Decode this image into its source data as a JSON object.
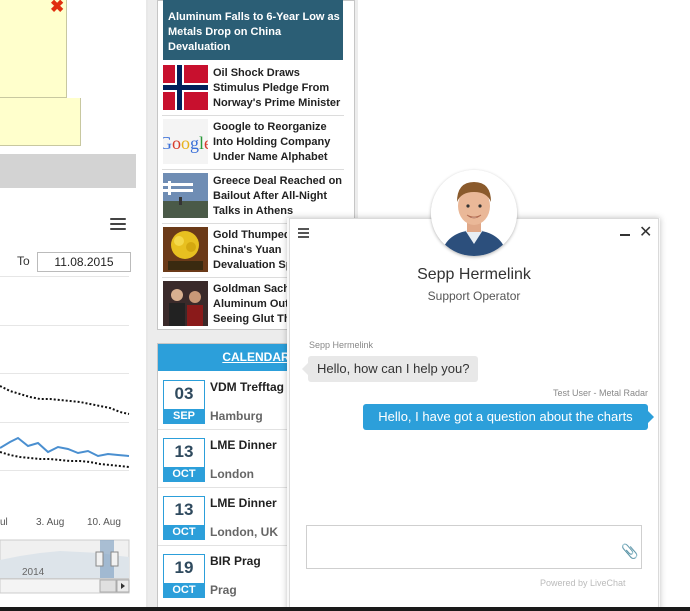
{
  "left_panel": {
    "close_glyph": "✖",
    "to_label": "To",
    "to_date": "11.08.2015",
    "x_ticks": [
      "ul",
      "3. Aug",
      "10. Aug"
    ],
    "navigator_year": "2014",
    "colors": {
      "line_blue": "#4a8fd0",
      "line_dotted": "#111111",
      "note_bg": "#ffffcc"
    }
  },
  "news": {
    "feature_title": "Aluminum Falls to 6-Year Low as Metals Drop on China Devaluation",
    "items": [
      {
        "title_lines": [
          "Oil Shock Draws",
          "Stimulus Pledge From",
          "Norway's Prime Minister"
        ],
        "thumb": "norway-flag-icon"
      },
      {
        "title_lines": [
          "Google to Reorganize",
          "Into Holding Company",
          "Under Name Alphabet"
        ],
        "thumb": "google-logo-icon"
      },
      {
        "title_lines": [
          "Greece Deal Reached on",
          "Bailout After All-Night",
          "Talks in Athens"
        ],
        "thumb": "greece-flag-icon"
      },
      {
        "title_lines": [
          "Gold Thumped",
          "China's Yuan",
          "Devaluation Sp"
        ],
        "thumb": "gold-icon"
      },
      {
        "title_lines": [
          "Goldman Sach",
          "Aluminum Out",
          "Seeing Glut Th"
        ],
        "thumb": "people-icon"
      }
    ]
  },
  "calendar": {
    "title": "CALENDAR",
    "events": [
      {
        "day": "03",
        "month": "SEP",
        "title": "VDM Trefftag",
        "location": "Hamburg"
      },
      {
        "day": "13",
        "month": "OCT",
        "title": "LME Dinner",
        "location": "London"
      },
      {
        "day": "13",
        "month": "OCT",
        "title": "LME Dinner",
        "location": "London, UK"
      },
      {
        "day": "19",
        "month": "OCT",
        "title": "BIR Prag",
        "location": "Prag"
      }
    ]
  },
  "chat": {
    "agent_name": "Sepp Hermelink",
    "agent_role": "Support Operator",
    "messages": [
      {
        "author": "Sepp Hermelink",
        "text": "Hello, how can I help you?"
      },
      {
        "author": "Test User - Metal Radar",
        "text": "Hello, I have got a question about the charts"
      }
    ],
    "powered_by": "Powered by LiveChat",
    "close_glyph": "✕",
    "clip_glyph": "📎",
    "colors": {
      "accent": "#2c9fda",
      "agent_bubble": "#e8e8e8"
    }
  }
}
